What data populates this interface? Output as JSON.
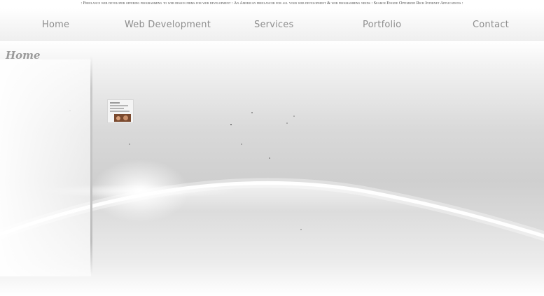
{
  "tagline": ": Freelance web developer offering programming to web design firms for web development : An American freelancer for all your web development & web programming needs : Search Engine Optimized Rich Internet Applications :",
  "nav": {
    "items": [
      {
        "label": "Home"
      },
      {
        "label": "Web Development"
      },
      {
        "label": "Services"
      },
      {
        "label": "Portfolio"
      },
      {
        "label": "Contact"
      }
    ]
  },
  "page": {
    "title": "Home"
  },
  "colors": {
    "nav_text": "#8e8e8e",
    "title_text": "#9a9a9a",
    "tagline_text": "#4a4a4a"
  }
}
